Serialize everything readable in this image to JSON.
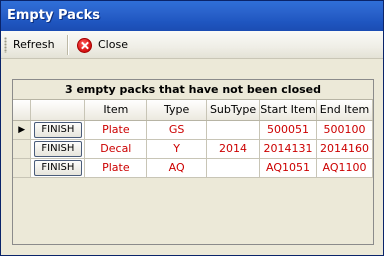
{
  "window": {
    "title": "Empty Packs"
  },
  "toolbar": {
    "refresh_label": "Refresh",
    "close_label": "Close"
  },
  "grid": {
    "caption": "3 empty packs that have not been closed",
    "columns": [
      "Item",
      "Type",
      "SubType",
      "Start Item",
      "End Item"
    ],
    "rows": [
      {
        "selected": true,
        "button": "FINISH",
        "item": "Plate",
        "type": "GS",
        "subtype": "",
        "start": "500051",
        "end": "500100"
      },
      {
        "selected": false,
        "button": "FINISH",
        "item": "Decal",
        "type": "Y",
        "subtype": "2014",
        "start": "2014131",
        "end": "2014160"
      },
      {
        "selected": false,
        "button": "FINISH",
        "item": "Plate",
        "type": "AQ",
        "subtype": "",
        "start": "AQ1051",
        "end": "AQ1100"
      }
    ]
  },
  "colors": {
    "titlebar": "#2a63cc",
    "cell_text": "#cc0000",
    "close_icon": "#d40f0f"
  },
  "icons": {
    "close": "close-icon",
    "row_pointer": "row-pointer-icon"
  }
}
